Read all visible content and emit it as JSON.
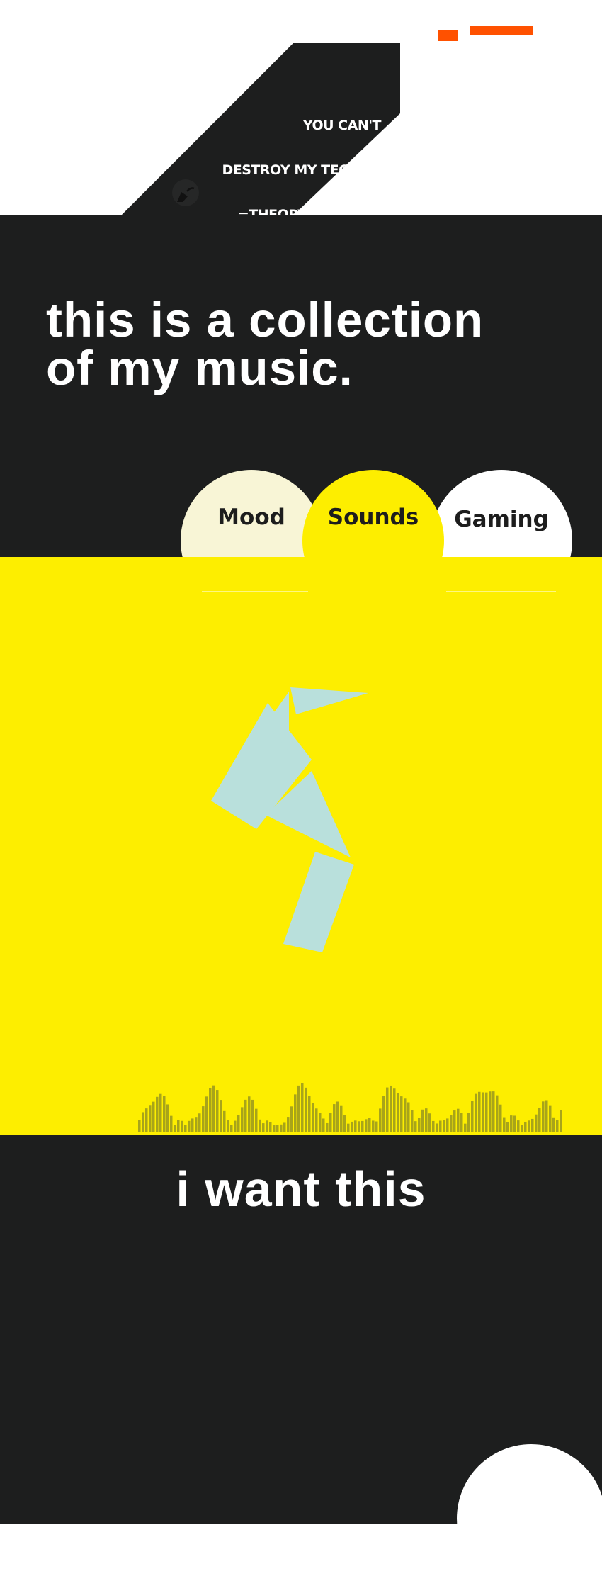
{
  "colors": {
    "dark": "#1d1e1e",
    "yellow": "#fdee00",
    "accent_orange": "#ff5100",
    "cream": "#f8f5d6",
    "white": "#ffffff",
    "bird": "#b9e0dc",
    "visualizer": "#a8a41a"
  },
  "header": {
    "menu_icon": "menu-icon",
    "logo": {
      "line1": "YOU CAN'T",
      "line2": "DESTROY MY TECHNO",
      "line3": "=THEORY RECORDS",
      "icon": "microphone-icon"
    }
  },
  "intro": {
    "title_line1": "this is a collection",
    "title_line2": "of my music."
  },
  "tabs": [
    {
      "label": "Mood",
      "color": "#f8f5d6",
      "active": false
    },
    {
      "label": "Sounds",
      "color": "#fdee00",
      "active": true
    },
    {
      "label": "Gaming",
      "color": "#ffffff",
      "active": false
    }
  ],
  "stage": {
    "illustration": "origami-bird-icon",
    "visualizer_icon": "audio-visualizer-icon"
  },
  "lower": {
    "title": "i want this"
  }
}
